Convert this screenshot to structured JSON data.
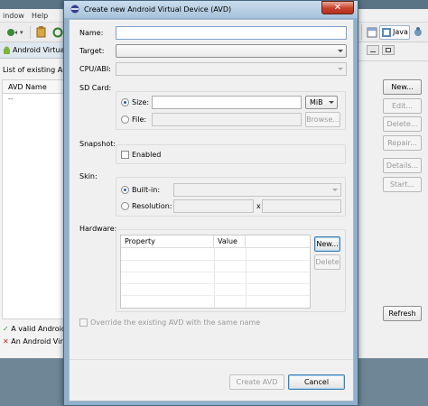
{
  "background": {
    "menu": [
      "indow",
      "Help"
    ],
    "perspective_label": "Java",
    "avd_tab_title": "Android Virtual I",
    "list_label": "List of existing Andr",
    "table_header": "AVD Name",
    "table_first_cell": "--",
    "buttons": {
      "new": "New...",
      "edit": "Edit...",
      "delete": "Delete...",
      "repair": "Repair...",
      "details": "Details...",
      "start": "Start...",
      "refresh": "Refresh"
    },
    "legend": {
      "valid": "A valid Android",
      "invalid": "An Android Virt"
    },
    "colors": {
      "valid": "#2a9a2a",
      "invalid": "#cc1f1f"
    }
  },
  "dialog": {
    "title": "Create new Android Virtual Device (AVD)",
    "close_glyph": "✕",
    "labels": {
      "name": "Name:",
      "target": "Target:",
      "cpu": "CPU/ABI:",
      "sdcard": "SD Card:",
      "snapshot": "Snapshot:",
      "skin": "Skin:",
      "hardware": "Hardware:"
    },
    "sdcard": {
      "size_label": "Size:",
      "unit": "MiB",
      "file_label": "File:",
      "browse": "Browse..."
    },
    "snapshot": {
      "enabled_label": "Enabled"
    },
    "skin": {
      "builtin_label": "Built-in:",
      "resolution_label": "Resolution:",
      "x_sep": "x"
    },
    "hardware": {
      "col_property": "Property",
      "col_value": "Value",
      "new_button": "New...",
      "delete_button": "Delete"
    },
    "override_label": "Override the existing AVD with the same name",
    "create_button": "Create AVD",
    "cancel_button": "Cancel"
  }
}
